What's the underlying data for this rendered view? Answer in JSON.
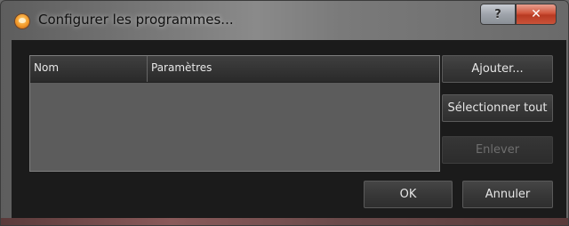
{
  "window": {
    "title": "Configurer les programmes...",
    "help_label": "?",
    "close_label": "✕",
    "icon": "app-flame-icon"
  },
  "list": {
    "columns": [
      "Nom",
      "Paramètres"
    ],
    "rows": []
  },
  "buttons": {
    "add": "Ajouter...",
    "select_all": "Sélectionner tout",
    "remove": "Enlever",
    "ok": "OK",
    "cancel": "Annuler"
  },
  "state": {
    "remove_enabled": false
  }
}
